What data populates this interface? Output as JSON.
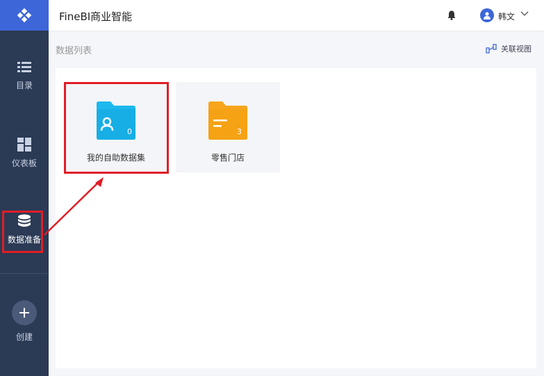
{
  "app": {
    "title": "FineBI商业智能"
  },
  "header": {
    "user_name": "韩文"
  },
  "sidebar": {
    "items": [
      {
        "label": "目录",
        "icon": "list-icon"
      },
      {
        "label": "仪表板",
        "icon": "dashboard-icon"
      },
      {
        "label": "数据准备",
        "icon": "database-icon",
        "active": true
      },
      {
        "label": "创建",
        "icon": "plus-icon"
      }
    ]
  },
  "content": {
    "breadcrumb": "数据列表",
    "association_view_label": "关联视图",
    "cards": [
      {
        "label": "我的自助数据集",
        "count": "0",
        "color": "#1cb8ee",
        "icon": "user-folder-icon",
        "highlighted": true
      },
      {
        "label": "零售门店",
        "count": "3",
        "color": "#f7a51c",
        "icon": "folder-icon"
      }
    ]
  },
  "colors": {
    "sidebar": "#2b3a55",
    "accent": "#3d66d8",
    "highlight": "#e01e26"
  }
}
